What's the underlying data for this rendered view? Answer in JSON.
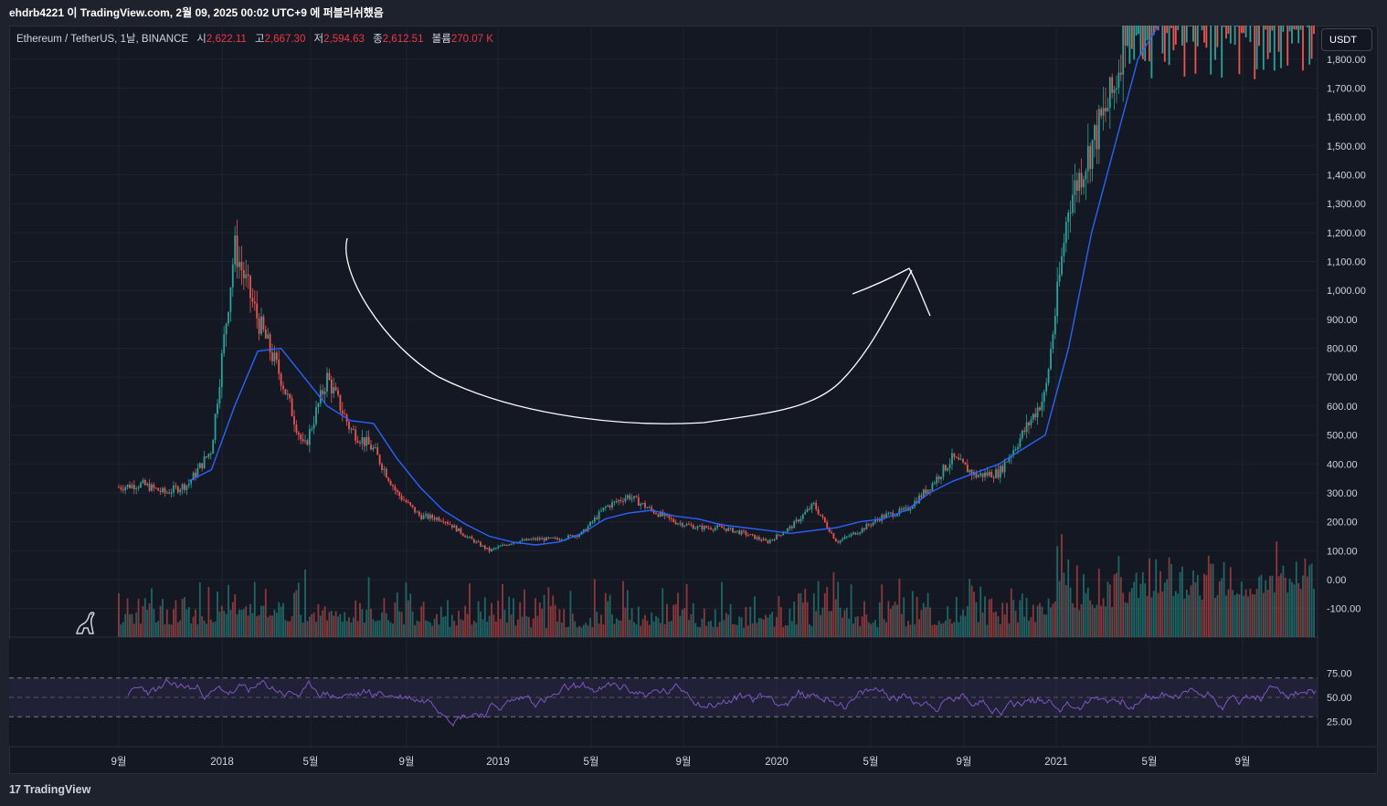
{
  "header": {
    "publish_line": "ehdrb4221 이 TradingView.com, 2월 09, 2025 00:02 UTC+9 에 퍼블리쉬했음"
  },
  "legend": {
    "symbol": "Ethereum / TetherUS, 1날, BINANCE",
    "open_label": "시",
    "open_value": "2,622.11",
    "high_label": "고",
    "high_value": "2,667.30",
    "low_label": "저",
    "low_value": "2,594.63",
    "close_label": "종",
    "close_value": "2,612.51",
    "volume_label": "볼륨",
    "volume_value": "270.07 K"
  },
  "unit_button": "USDT",
  "footer": {
    "brand": "TradingView",
    "logo_glyph": "17"
  },
  "colors": {
    "up": "#26a69a",
    "down": "#ef5350",
    "ma": "#2962ff",
    "rsi": "#7e57c2",
    "background": "#141823",
    "drawing": "#ffffff"
  },
  "chart_data": [
    {
      "type": "line",
      "title": "Ethereum / TetherUS, 1날, BINANCE",
      "x_ticks": [
        "9월",
        "2018",
        "5월",
        "9월",
        "2019",
        "5월",
        "9월",
        "2020",
        "5월",
        "9월",
        "2021",
        "5월",
        "9월"
      ],
      "y_ticks": [
        "1,800.00",
        "1,700.00",
        "1,600.00",
        "1,500.00",
        "1,400.00",
        "1,300.00",
        "1,200.00",
        "1,100.00",
        "1,000.00",
        "900.00",
        "800.00",
        "700.00",
        "600.00",
        "500.00",
        "400.00",
        "300.00",
        "200.00",
        "100.00",
        "0.00",
        "-100.00"
      ],
      "ylim": [
        -200,
        1900
      ],
      "series": [
        {
          "name": "",
          "style": "candles",
          "x": [
            "2017-08",
            "2017-09",
            "2017-10",
            "2017-11",
            "2017-12",
            "2018-01",
            "2018-02",
            "2018-03",
            "2018-04",
            "2018-05",
            "2018-06",
            "2018-07",
            "2018-08",
            "2018-09",
            "2018-10",
            "2018-11",
            "2018-12",
            "2019-01",
            "2019-02",
            "2019-03",
            "2019-04",
            "2019-05",
            "2019-06",
            "2019-07",
            "2019-08",
            "2019-09",
            "2019-10",
            "2019-11",
            "2019-12",
            "2020-01",
            "2020-02",
            "2020-03",
            "2020-04",
            "2020-05",
            "2020-06",
            "2020-07",
            "2020-08",
            "2020-09",
            "2020-10",
            "2020-11",
            "2020-12",
            "2021-01",
            "2021-02",
            "2021-03",
            "2021-04",
            "2021-05",
            "2021-06",
            "2021-07",
            "2021-08",
            "2021-09",
            "2021-10",
            "2021-11"
          ],
          "values": [
            320,
            330,
            300,
            330,
            450,
            1150,
            900,
            700,
            450,
            700,
            520,
            450,
            300,
            220,
            210,
            150,
            100,
            130,
            140,
            140,
            160,
            250,
            290,
            240,
            200,
            180,
            180,
            160,
            130,
            180,
            260,
            130,
            170,
            220,
            240,
            320,
            420,
            360,
            370,
            500,
            640,
            1300,
            1500,
            1700,
            2200,
            2500,
            2300,
            2200,
            2600,
            2400,
            2600,
            2700
          ]
        },
        {
          "name": "",
          "style": "moving-average",
          "x": [
            "2017-11",
            "2017-12",
            "2018-01",
            "2018-02",
            "2018-03",
            "2018-04",
            "2018-05",
            "2018-06",
            "2018-07",
            "2018-08",
            "2018-09",
            "2018-10",
            "2018-11",
            "2018-12",
            "2019-01",
            "2019-02",
            "2019-03",
            "2019-04",
            "2019-05",
            "2019-06",
            "2019-07",
            "2019-08",
            "2019-09",
            "2019-10",
            "2019-11",
            "2019-12",
            "2020-01",
            "2020-02",
            "2020-03",
            "2020-04",
            "2020-05",
            "2020-06",
            "2020-07",
            "2020-08",
            "2020-09",
            "2020-10",
            "2020-11",
            "2020-12",
            "2021-01",
            "2021-02",
            "2021-03",
            "2021-04",
            "2021-05"
          ],
          "values": [
            340,
            380,
            600,
            790,
            800,
            700,
            600,
            550,
            540,
            420,
            320,
            240,
            190,
            150,
            130,
            120,
            130,
            160,
            210,
            230,
            240,
            220,
            210,
            190,
            180,
            170,
            160,
            170,
            180,
            200,
            210,
            240,
            300,
            340,
            370,
            400,
            450,
            500,
            800,
            1200,
            1500,
            1800,
            2100
          ]
        }
      ],
      "annotation": "hand-drawn cup-shaped curve with arrow pointing up-right"
    },
    {
      "type": "bar",
      "title": "",
      "series": [
        {
          "name": "",
          "style": "volume"
        }
      ]
    },
    {
      "type": "line",
      "title": "",
      "y_ticks": [
        "75.00",
        "50.00",
        "25.00"
      ],
      "ylim": [
        15,
        92
      ],
      "bands": [
        30,
        50,
        70
      ],
      "series": [
        {
          "name": "",
          "style": "rsi"
        }
      ]
    }
  ]
}
